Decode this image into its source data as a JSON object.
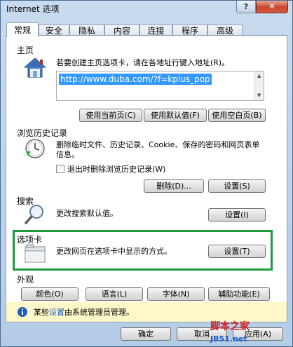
{
  "window": {
    "title": "Internet 选项",
    "help_label": "?",
    "close_label": "✕"
  },
  "tabs": [
    {
      "label": "常规"
    },
    {
      "label": "安全"
    },
    {
      "label": "隐私"
    },
    {
      "label": "内容"
    },
    {
      "label": "连接"
    },
    {
      "label": "程序"
    },
    {
      "label": "高级"
    }
  ],
  "home": {
    "heading": "主页",
    "description": "若要创建主页选项卡，请在各地址行键入地址(R)。",
    "url": "http://www.duba.com/?f=kplus_pop",
    "btn_current": "使用当前页(C)",
    "btn_default": "使用默认值(F)",
    "btn_blank": "使用空白页(B)"
  },
  "history": {
    "heading": "浏览历史记录",
    "description": "删除临时文件、历史记录、Cookie、保存的密码和网页表单信息。",
    "checkbox_label": "退出时删除浏览历史记录(W)",
    "btn_delete": "删除(D)...",
    "btn_settings": "设置(S)"
  },
  "search": {
    "heading": "搜索",
    "description": "更改搜索默认值。",
    "btn_settings": "设置(I)"
  },
  "tabs_section": {
    "heading": "选项卡",
    "description": "更改网页在选项卡中显示的方式。",
    "btn_settings": "设置(T)"
  },
  "appearance": {
    "heading": "外观",
    "btn_colors": "颜色(O)",
    "btn_languages": "语言(L)",
    "btn_fonts": "字体(N)",
    "btn_accessibility": "辅助功能(E)"
  },
  "info": {
    "prefix": "某些",
    "link": "设置",
    "suffix": "由系统管理员管理。"
  },
  "footer": {
    "btn_ok": "确定",
    "btn_cancel": "取消",
    "btn_apply": "应用(A)"
  },
  "watermark": {
    "text": "脚本之家",
    "sub": "JB51.net"
  },
  "colors": {
    "highlight": "#1b9b3b",
    "selection": "#3399ff",
    "link": "#1a5bc8"
  },
  "icons": [
    "house-icon",
    "history-clock-icon",
    "magnifier-icon",
    "tab-window-icon",
    "info-icon"
  ]
}
